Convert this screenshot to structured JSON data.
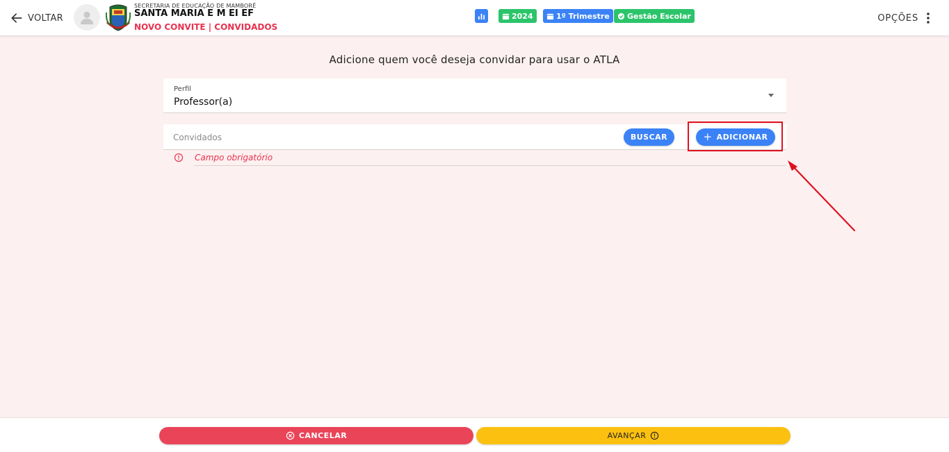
{
  "header": {
    "back_label": "VOLTAR",
    "org_small": "SECRETARIA DE EDUCAÇÃO DE MAMBORÊ",
    "school_name": "SANTA MARIA E M EI EF",
    "page_subtitle": "NOVO CONVITE | CONVIDADOS",
    "chips": {
      "stats_icon": "bar-chart-icon",
      "year": "2024",
      "term": "1º Trimestre",
      "module": "Gestão Escolar"
    },
    "options_label": "OPÇÕES"
  },
  "main": {
    "title": "Adicione quem você deseja convidar para usar o ATLA",
    "profile": {
      "label": "Perfil",
      "value": "Professor(a)"
    },
    "guests": {
      "placeholder": "Convidados",
      "search_label": "BUSCAR",
      "add_label": "ADICIONAR",
      "error": "Campo obrigatório"
    }
  },
  "footer": {
    "cancel_label": "CANCELAR",
    "next_label": "AVANÇAR"
  },
  "colors": {
    "background": "#fcf1f0",
    "primary_blue": "#3b82f6",
    "success_green": "#2cc46a",
    "danger_red": "#ea4459",
    "warning_yellow": "#fcc110",
    "annotation_red": "#e01020"
  }
}
